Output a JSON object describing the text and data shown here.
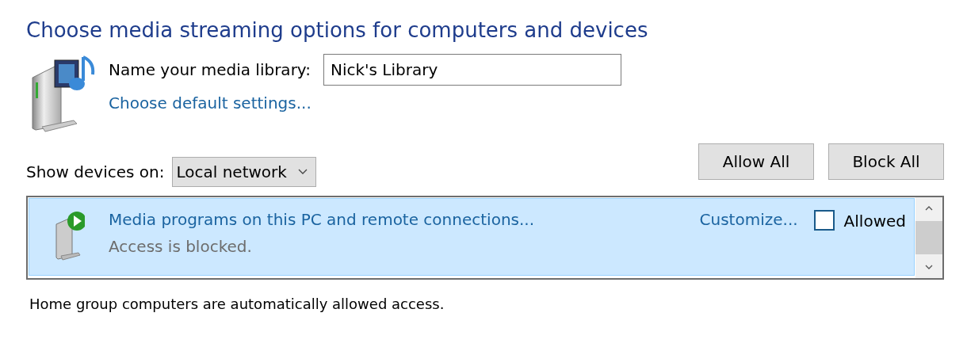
{
  "heading": "Choose media streaming options for computers and devices",
  "library": {
    "label": "Name your media library:",
    "value": "Nick's Library",
    "link": "Choose default settings..."
  },
  "show_devices": {
    "label": "Show devices on:",
    "value": "Local network"
  },
  "buttons": [
    "Allow All",
    "Block All"
  ],
  "devices": [
    {
      "name": "Media programs on this PC and remote connections...",
      "status": "Access is blocked.",
      "customize": "Customize...",
      "allowed_label": "Allowed",
      "checked": false,
      "selected": true
    }
  ],
  "footer": "Home group computers are automatically allowed access."
}
